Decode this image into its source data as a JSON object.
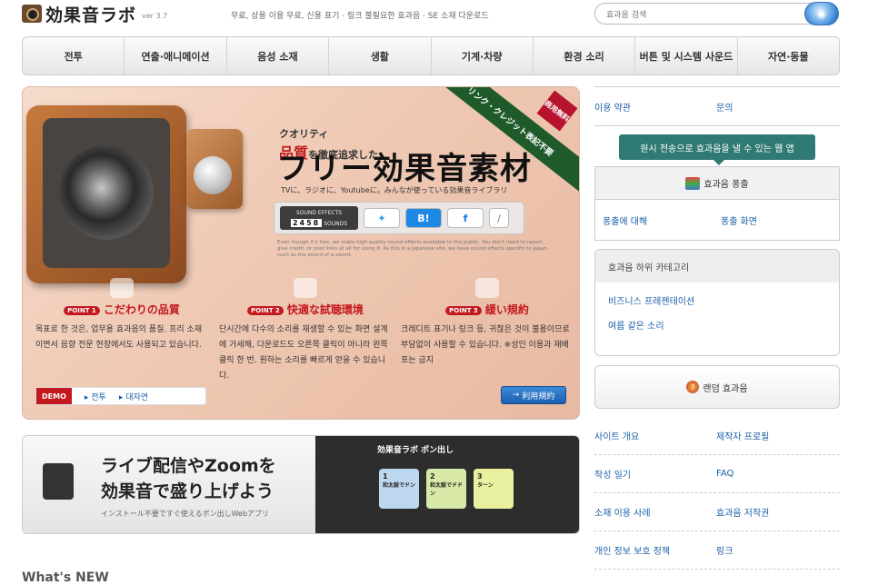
{
  "header": {
    "logo_text": "効果音ラボ",
    "version": "ver 3.7",
    "tagline": "무료, 상용 이용 무료, 신용 표기 · 링크 불필요한 효과음 · SE 소재 다운로드",
    "search_placeholder": "효과음 검색",
    "search_button_icon": "globe-search-icon"
  },
  "nav": [
    "전투",
    "연출·애니메이션",
    "음성 소재",
    "생활",
    "기계·차량",
    "환경 소리",
    "버튼 및 시스템 사운드",
    "자연·동물"
  ],
  "hero": {
    "ribbon": "リンク・クレジット表記不要",
    "ribbon_tag": "商用無料",
    "quality_prefix": "クオリティ",
    "quality": "品質",
    "quality_rest": "を徹底追求した",
    "title": "フリー効果音素材",
    "subtitle": "TVに、ラジオに、Youtubeに。みんなが使っている効果音ライブラリ",
    "counter_label": "SOUND EFFECTS",
    "counter_value": "2458",
    "counter_unit": "SOUNDS",
    "english_note": "Even though it's free, we make high quality sound effects available to the public. You don't need to report, give credit, or post links at all for using it. As this is a Japanese site, we have sound effects specific to Japan such as the sound of a sword.",
    "points": [
      {
        "tag": "POINT 1",
        "title": "こだわりの品質",
        "body": "목표로 한 것은, 업무용 효과음의 품질. 프리 소재이면서 음향 전문 현장에서도 사용되고 있습니다."
      },
      {
        "tag": "POINT 2",
        "title": "快適な試聴環境",
        "body": "단시간에 다수의 소리를 재생할 수 있는 화면 설계에 가세해, 다운로드도 오른쪽 클릭이 아니라 왼쪽 클릭 한 번. 원하는 소리를 빠르게 얻을 수 있습니다."
      },
      {
        "tag": "POINT 3",
        "title": "緩い規約",
        "body": "크레디트 표기나 링크 등, 귀찮은 것이 불용이므로 부담없이 사용할 수 있습니다. ※성인 이용과 재배포는 금지"
      }
    ],
    "demo_label": "DEMO",
    "demo_links": [
      "전투",
      "대자연"
    ],
    "rules_button": "利用規約"
  },
  "banner": {
    "line1": "ライブ配信やZoomを",
    "line2": "効果音で盛り上げよう",
    "line3": "インストール不要ですぐ使えるポン出しWebアプリ",
    "app_label": "効果音ラボ ポン出し",
    "pads": [
      {
        "num": "1",
        "label": "和太鼓でドン"
      },
      {
        "num": "2",
        "label": "和太鼓でドドン"
      },
      {
        "num": "3",
        "label": "ターン"
      }
    ]
  },
  "whats_new": "What's NEW",
  "sidebar": {
    "top_links": [
      "이용 약관",
      "문의"
    ],
    "app_badge": "원시 전송으로 효과음을 낼 수 있는 웹 앱",
    "gacha_title": "효과음 퐁출",
    "gacha_links": [
      "퐁출에 대해",
      "퐁출 화면"
    ],
    "subcat_title": "효과음 하위 카테고리",
    "subcat_links": [
      "비즈니스 프레젠테이션",
      "여름 같은 소리"
    ],
    "random": "랜덤 효과음",
    "links": [
      [
        "사이트 개요",
        "제작자 프로필"
      ],
      [
        "작성 일기",
        "FAQ"
      ],
      [
        "소재 이용 사례",
        "효과음 저작권"
      ],
      [
        "개인 정보 보호 정책",
        "링크"
      ]
    ]
  }
}
